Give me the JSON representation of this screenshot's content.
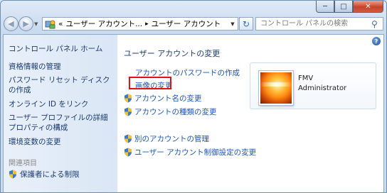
{
  "window": {
    "controls": {
      "minimize": "─",
      "maximize": "□",
      "close": "✕"
    }
  },
  "nav": {
    "back_icon": "◀",
    "forward_icon": "▶",
    "address": {
      "overflow": "«",
      "crumbs": [
        "ユーザー アカウント...",
        "ユーザー アカウント"
      ]
    },
    "search_placeholder": "コントロール パネルの検索"
  },
  "sidebar": {
    "title": "コントロール パネル ホーム",
    "items": [
      {
        "label": "資格情報の管理"
      },
      {
        "label": "パスワード リセット ディスク"
      },
      {
        "label": "の作成"
      },
      {
        "label": "オンライン ID をリンク"
      },
      {
        "label": "ユーザー プロファイルの詳細"
      },
      {
        "label": "プロパティの構成"
      },
      {
        "label": "環境変数の変更"
      }
    ],
    "related_heading": "関連項目",
    "related_items": [
      {
        "label": "保護者による制限"
      }
    ]
  },
  "main": {
    "title": "ユーザー アカウントの変更",
    "tasks": [
      {
        "label": "アカウントのパスワードの作成"
      },
      {
        "label": "画像の変更"
      },
      {
        "label": "アカウント名の変更"
      },
      {
        "label": "アカウントの種類の変更"
      },
      {
        "label": "別のアカウントの管理"
      },
      {
        "label": "ユーザー アカウント制御設定の変更"
      }
    ],
    "user": {
      "name": "FMV",
      "role": "Administrator"
    }
  },
  "colors": {
    "link": "#1b56b8",
    "highlight": "#e21010"
  }
}
